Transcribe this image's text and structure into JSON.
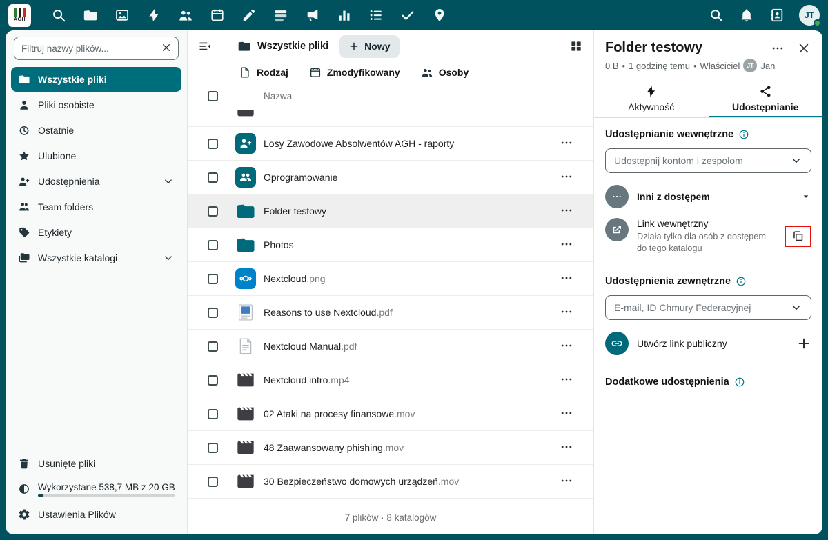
{
  "topbar": {
    "logo_text": "AGH",
    "user_initials": "JT",
    "app_icons": [
      "search",
      "files",
      "photos",
      "activity",
      "contacts",
      "calendar",
      "notes",
      "deck",
      "announcements",
      "analytics",
      "tasks",
      "done",
      "maps"
    ],
    "right_icons": [
      "unified-search",
      "notifications",
      "contacts-menu"
    ]
  },
  "glyphs": {
    "bullet": "•"
  },
  "sidebar": {
    "filter_placeholder": "Filtruj nazwy plików...",
    "items": [
      {
        "label": "Wszystkie pliki",
        "icon": "folder",
        "active": true
      },
      {
        "label": "Pliki osobiste",
        "icon": "user"
      },
      {
        "label": "Ostatnie",
        "icon": "history"
      },
      {
        "label": "Ulubione",
        "icon": "star"
      },
      {
        "label": "Udostępnienia",
        "icon": "share-user",
        "expandable": true
      },
      {
        "label": "Team folders",
        "icon": "group"
      },
      {
        "label": "Etykiety",
        "icon": "tag"
      },
      {
        "label": "Wszystkie katalogi",
        "icon": "folders",
        "expandable": true
      }
    ],
    "footer": {
      "trash": "Usunięte pliki",
      "quota": "Wykorzystane 538,7 MB z 20 GB",
      "settings": "Ustawienia Plików"
    }
  },
  "main": {
    "breadcrumb": "Wszystkie pliki",
    "new_button": "Nowy",
    "filters": [
      "Rodzaj",
      "Zmodyfikowany",
      "Osoby"
    ],
    "columns": {
      "name": "Nazwa"
    },
    "files": [
      {
        "base": "",
        "ext": "",
        "icon": "video-partial"
      },
      {
        "base": "Losy Zawodowe Absolwentów AGH - raporty",
        "ext": "",
        "icon": "folder-shared"
      },
      {
        "base": "Oprogramowanie",
        "ext": "",
        "icon": "folder-group"
      },
      {
        "base": "Folder testowy",
        "ext": "",
        "icon": "folder",
        "selected": true
      },
      {
        "base": "Photos",
        "ext": "",
        "icon": "folder"
      },
      {
        "base": "Nextcloud",
        "ext": ".png",
        "icon": "nextcloud-image"
      },
      {
        "base": "Reasons to use Nextcloud",
        "ext": ".pdf",
        "icon": "pdf-image"
      },
      {
        "base": "Nextcloud Manual",
        "ext": ".pdf",
        "icon": "pdf-document"
      },
      {
        "base": "Nextcloud intro",
        "ext": ".mp4",
        "icon": "video"
      },
      {
        "base": "02 Ataki na procesy finansowe",
        "ext": ".mov",
        "icon": "video"
      },
      {
        "base": "48 Zaawansowany phishing",
        "ext": ".mov",
        "icon": "video"
      },
      {
        "base": "30 Bezpieczeństwo domowych urządzeń",
        "ext": ".mov",
        "icon": "video"
      }
    ],
    "summary": "7 plików · 8 katalogów"
  },
  "details": {
    "title": "Folder testowy",
    "meta": {
      "size": "0 B",
      "time": "1 godzinę temu",
      "owner_label": "Właściciel",
      "owner_initials": "JT",
      "owner_name": "Jan"
    },
    "tabs": [
      {
        "label": "Aktywność",
        "icon": "lightning"
      },
      {
        "label": "Udostępnianie",
        "icon": "share",
        "active": true
      }
    ],
    "internal": {
      "heading": "Udostępnianie wewnętrzne",
      "select_placeholder": "Udostępnij kontom i zespołom",
      "others_label": "Inni z dostępem",
      "link_title": "Link wewnętrzny",
      "link_subtitle": "Działa tylko dla osób z dostępem do tego katalogu"
    },
    "external": {
      "heading": "Udostępnienia zewnętrzne",
      "select_placeholder": "E-mail, ID Chmury Federacyjnej",
      "create_link_label": "Utwórz link publiczny"
    },
    "additional": {
      "heading": "Dodatkowe udostępnienia"
    }
  },
  "colors": {
    "topbar": "#00525f",
    "primary": "#006d7d",
    "tab_underline": "#00788a",
    "selected_row": "#efefef",
    "annotation_red": "#e8100c",
    "nextcloud_blue": "#0082c9",
    "status_green": "#3fae52"
  }
}
